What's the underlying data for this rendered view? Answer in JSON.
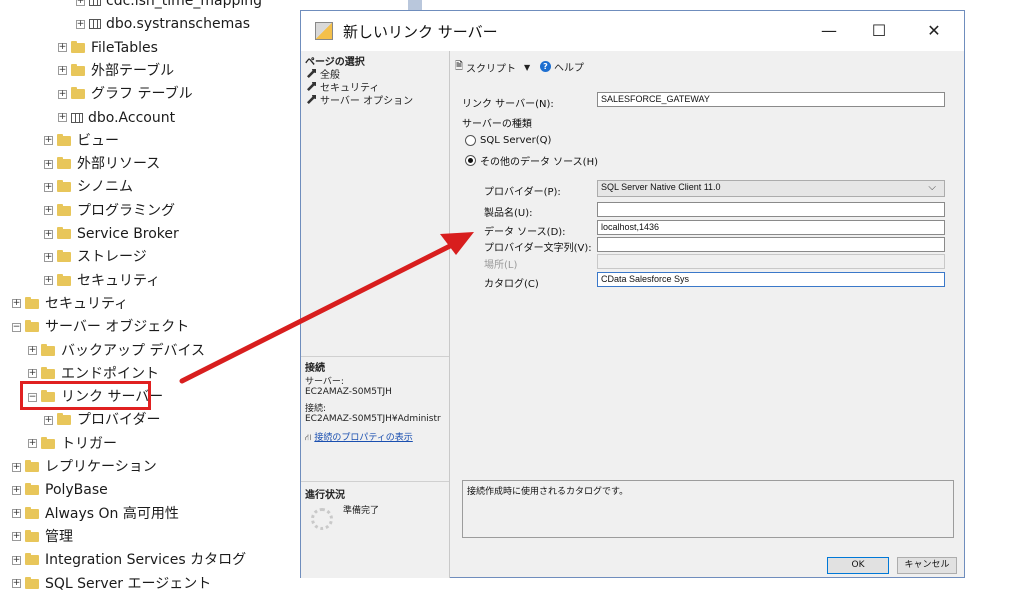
{
  "tree": {
    "items": [
      {
        "label": "cdc.lsn_time_mapping",
        "kind": "table",
        "indent": 4
      },
      {
        "label": "dbo.systranschemas",
        "kind": "table",
        "indent": 4
      },
      {
        "label": "FileTables",
        "kind": "folder",
        "indent": 3
      },
      {
        "label": "外部テーブル",
        "kind": "folder",
        "indent": 3
      },
      {
        "label": "グラフ テーブル",
        "kind": "folder",
        "indent": 3
      },
      {
        "label": "dbo.Account",
        "kind": "table",
        "indent": 3
      },
      {
        "label": "ビュー",
        "kind": "folder",
        "indent": 2
      },
      {
        "label": "外部リソース",
        "kind": "folder",
        "indent": 2
      },
      {
        "label": "シノニム",
        "kind": "folder",
        "indent": 2
      },
      {
        "label": "プログラミング",
        "kind": "folder",
        "indent": 2
      },
      {
        "label": "Service Broker",
        "kind": "folder",
        "indent": 2
      },
      {
        "label": "ストレージ",
        "kind": "folder",
        "indent": 2
      },
      {
        "label": "セキュリティ",
        "kind": "folder",
        "indent": 2
      },
      {
        "label": "セキュリティ",
        "kind": "folder",
        "indent": 0
      },
      {
        "label": "サーバー オブジェクト",
        "kind": "folder",
        "indent": 0,
        "expanded": true
      },
      {
        "label": "バックアップ デバイス",
        "kind": "folder",
        "indent": 1
      },
      {
        "label": "エンドポイント",
        "kind": "folder",
        "indent": 1
      },
      {
        "label": "リンク サーバー",
        "kind": "folder",
        "indent": 1,
        "expanded": true
      },
      {
        "label": "プロバイダー",
        "kind": "folder",
        "indent": 2
      },
      {
        "label": "トリガー",
        "kind": "folder",
        "indent": 1
      },
      {
        "label": "レプリケーション",
        "kind": "folder",
        "indent": 0
      },
      {
        "label": "PolyBase",
        "kind": "folder",
        "indent": 0
      },
      {
        "label": "Always On 高可用性",
        "kind": "folder",
        "indent": 0
      },
      {
        "label": "管理",
        "kind": "folder",
        "indent": 0
      },
      {
        "label": "Integration Services カタログ",
        "kind": "folder",
        "indent": 0
      },
      {
        "label": "SQL Server エージェント",
        "kind": "folder",
        "indent": 0
      }
    ]
  },
  "dialog": {
    "title": "新しいリンク サーバー",
    "minimize": "—",
    "maximize": "☐",
    "close": "✕",
    "page_select_header": "ページの選択",
    "pages": [
      "全般",
      "セキュリティ",
      "サーバー オプション"
    ],
    "connection_header": "接続",
    "server_label": "サーバー:",
    "server_value": "EC2AMAZ-S0M5TJH",
    "connection_label": "接続:",
    "connection_value": "EC2AMAZ-S0M5TJH¥Administr",
    "connection_props_link": "接続のプロパティの表示",
    "progress_header": "進行状況",
    "progress_status": "準備完了",
    "toolbar": {
      "script": "スクリプト",
      "help": "ヘルプ"
    },
    "linked_server_label": "リンク サーバー(N):",
    "linked_server_value": "SALESFORCE_GATEWAY",
    "server_type_label": "サーバーの種類",
    "radio_sql_server": "SQL Server(Q)",
    "radio_other": "その他のデータ ソース(H)",
    "provider_label": "プロバイダー(P):",
    "provider_value": "SQL Server Native Client 11.0",
    "product_label": "製品名(U):",
    "product_value": "",
    "datasource_label": "データ ソース(D):",
    "datasource_value": "localhost,1436",
    "provider_string_label": "プロバイダー文字列(V):",
    "provider_string_value": "",
    "location_label": "場所(L)",
    "location_value": "",
    "catalog_label": "カタログ(C)",
    "catalog_value": "CData Salesforce Sys",
    "description": "接続作成時に使用されるカタログです。",
    "ok": "OK",
    "cancel": "キャンセル"
  },
  "colors": {
    "highlight": "#e02020",
    "arrow": "#d81e1e",
    "folder": "#e8c65a",
    "accent": "#0078d7"
  }
}
